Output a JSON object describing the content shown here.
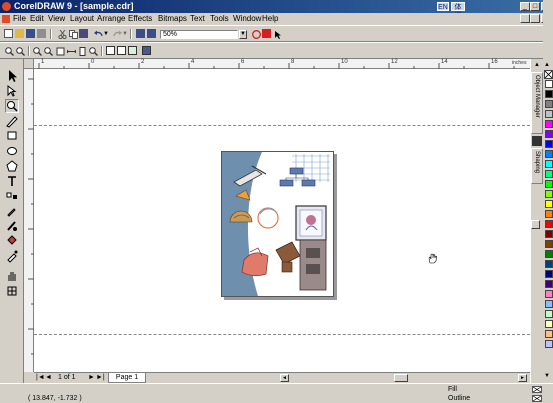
{
  "window": {
    "title": "CorelDRAW 9 - [sample.cdr]",
    "ime_left": "EN",
    "ime_right": "体闪",
    "min_label": "_",
    "max_label": "□",
    "close_label": "×"
  },
  "menu": [
    "File",
    "Edit",
    "View",
    "Layout",
    "Arrange",
    "Effects",
    "Bitmaps",
    "Text",
    "Tools",
    "Window",
    "Help"
  ],
  "standard_toolbar": {
    "zoom_value": "50%"
  },
  "rulers": {
    "h_ticks": [
      "1",
      "0",
      "2",
      "4",
      "6",
      "8",
      "10",
      "12",
      "14",
      "16"
    ],
    "units": "inches"
  },
  "docker_tabs": [
    "Object Manager",
    "Shaping"
  ],
  "page_nav": {
    "first": "|◄",
    "prev": "◄",
    "counter": "1 of 1",
    "next": "►",
    "last": "►|",
    "tab": "Page 1"
  },
  "status": {
    "coords": "( 13.847, -1.732 )",
    "fill_label": "Fill",
    "outline_label": "Outline"
  },
  "palette_colors": [
    "#ffffff",
    "#000000",
    "#808080",
    "#c0c0c0",
    "#ff00ff",
    "#8000ff",
    "#0000ff",
    "#0080ff",
    "#00ffff",
    "#00ff80",
    "#00ff00",
    "#80ff00",
    "#ffff00",
    "#ff8000",
    "#ff0000",
    "#800000",
    "#804000",
    "#008000",
    "#004080",
    "#000080",
    "#400080",
    "#ff80c0",
    "#80c0ff",
    "#c0ffc0",
    "#ffffc0",
    "#ffc080",
    "#c0c0ff"
  ]
}
